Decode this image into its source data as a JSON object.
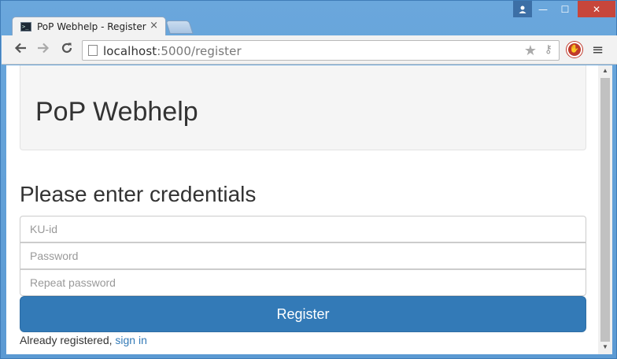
{
  "browser": {
    "tab_title": "PoP Webhelp - Register",
    "tab_close": "×",
    "url_host": "localhost",
    "url_path": ":5000/register",
    "win_min": "—",
    "win_max": "☐",
    "win_close": "✕",
    "icons": {
      "back": "back-arrow-icon",
      "forward": "forward-arrow-icon",
      "reload": "reload-icon",
      "bookmark": "star-icon",
      "key": "key-icon",
      "extension": "stop-hand-icon",
      "menu": "hamburger-menu-icon",
      "profile": "user-icon"
    }
  },
  "page": {
    "site_title": "PoP Webhelp",
    "form_heading": "Please enter credentials",
    "fields": {
      "ku_id_placeholder": "KU-id",
      "password_placeholder": "Password",
      "repeat_password_placeholder": "Repeat password"
    },
    "register_label": "Register",
    "already_text": "Already registered, ",
    "sign_in_link": "sign in"
  },
  "colors": {
    "primary": "#337ab7",
    "jumbotron_bg": "#f5f5f5",
    "frame": "#5f9fd8",
    "close_button": "#c7463b"
  }
}
